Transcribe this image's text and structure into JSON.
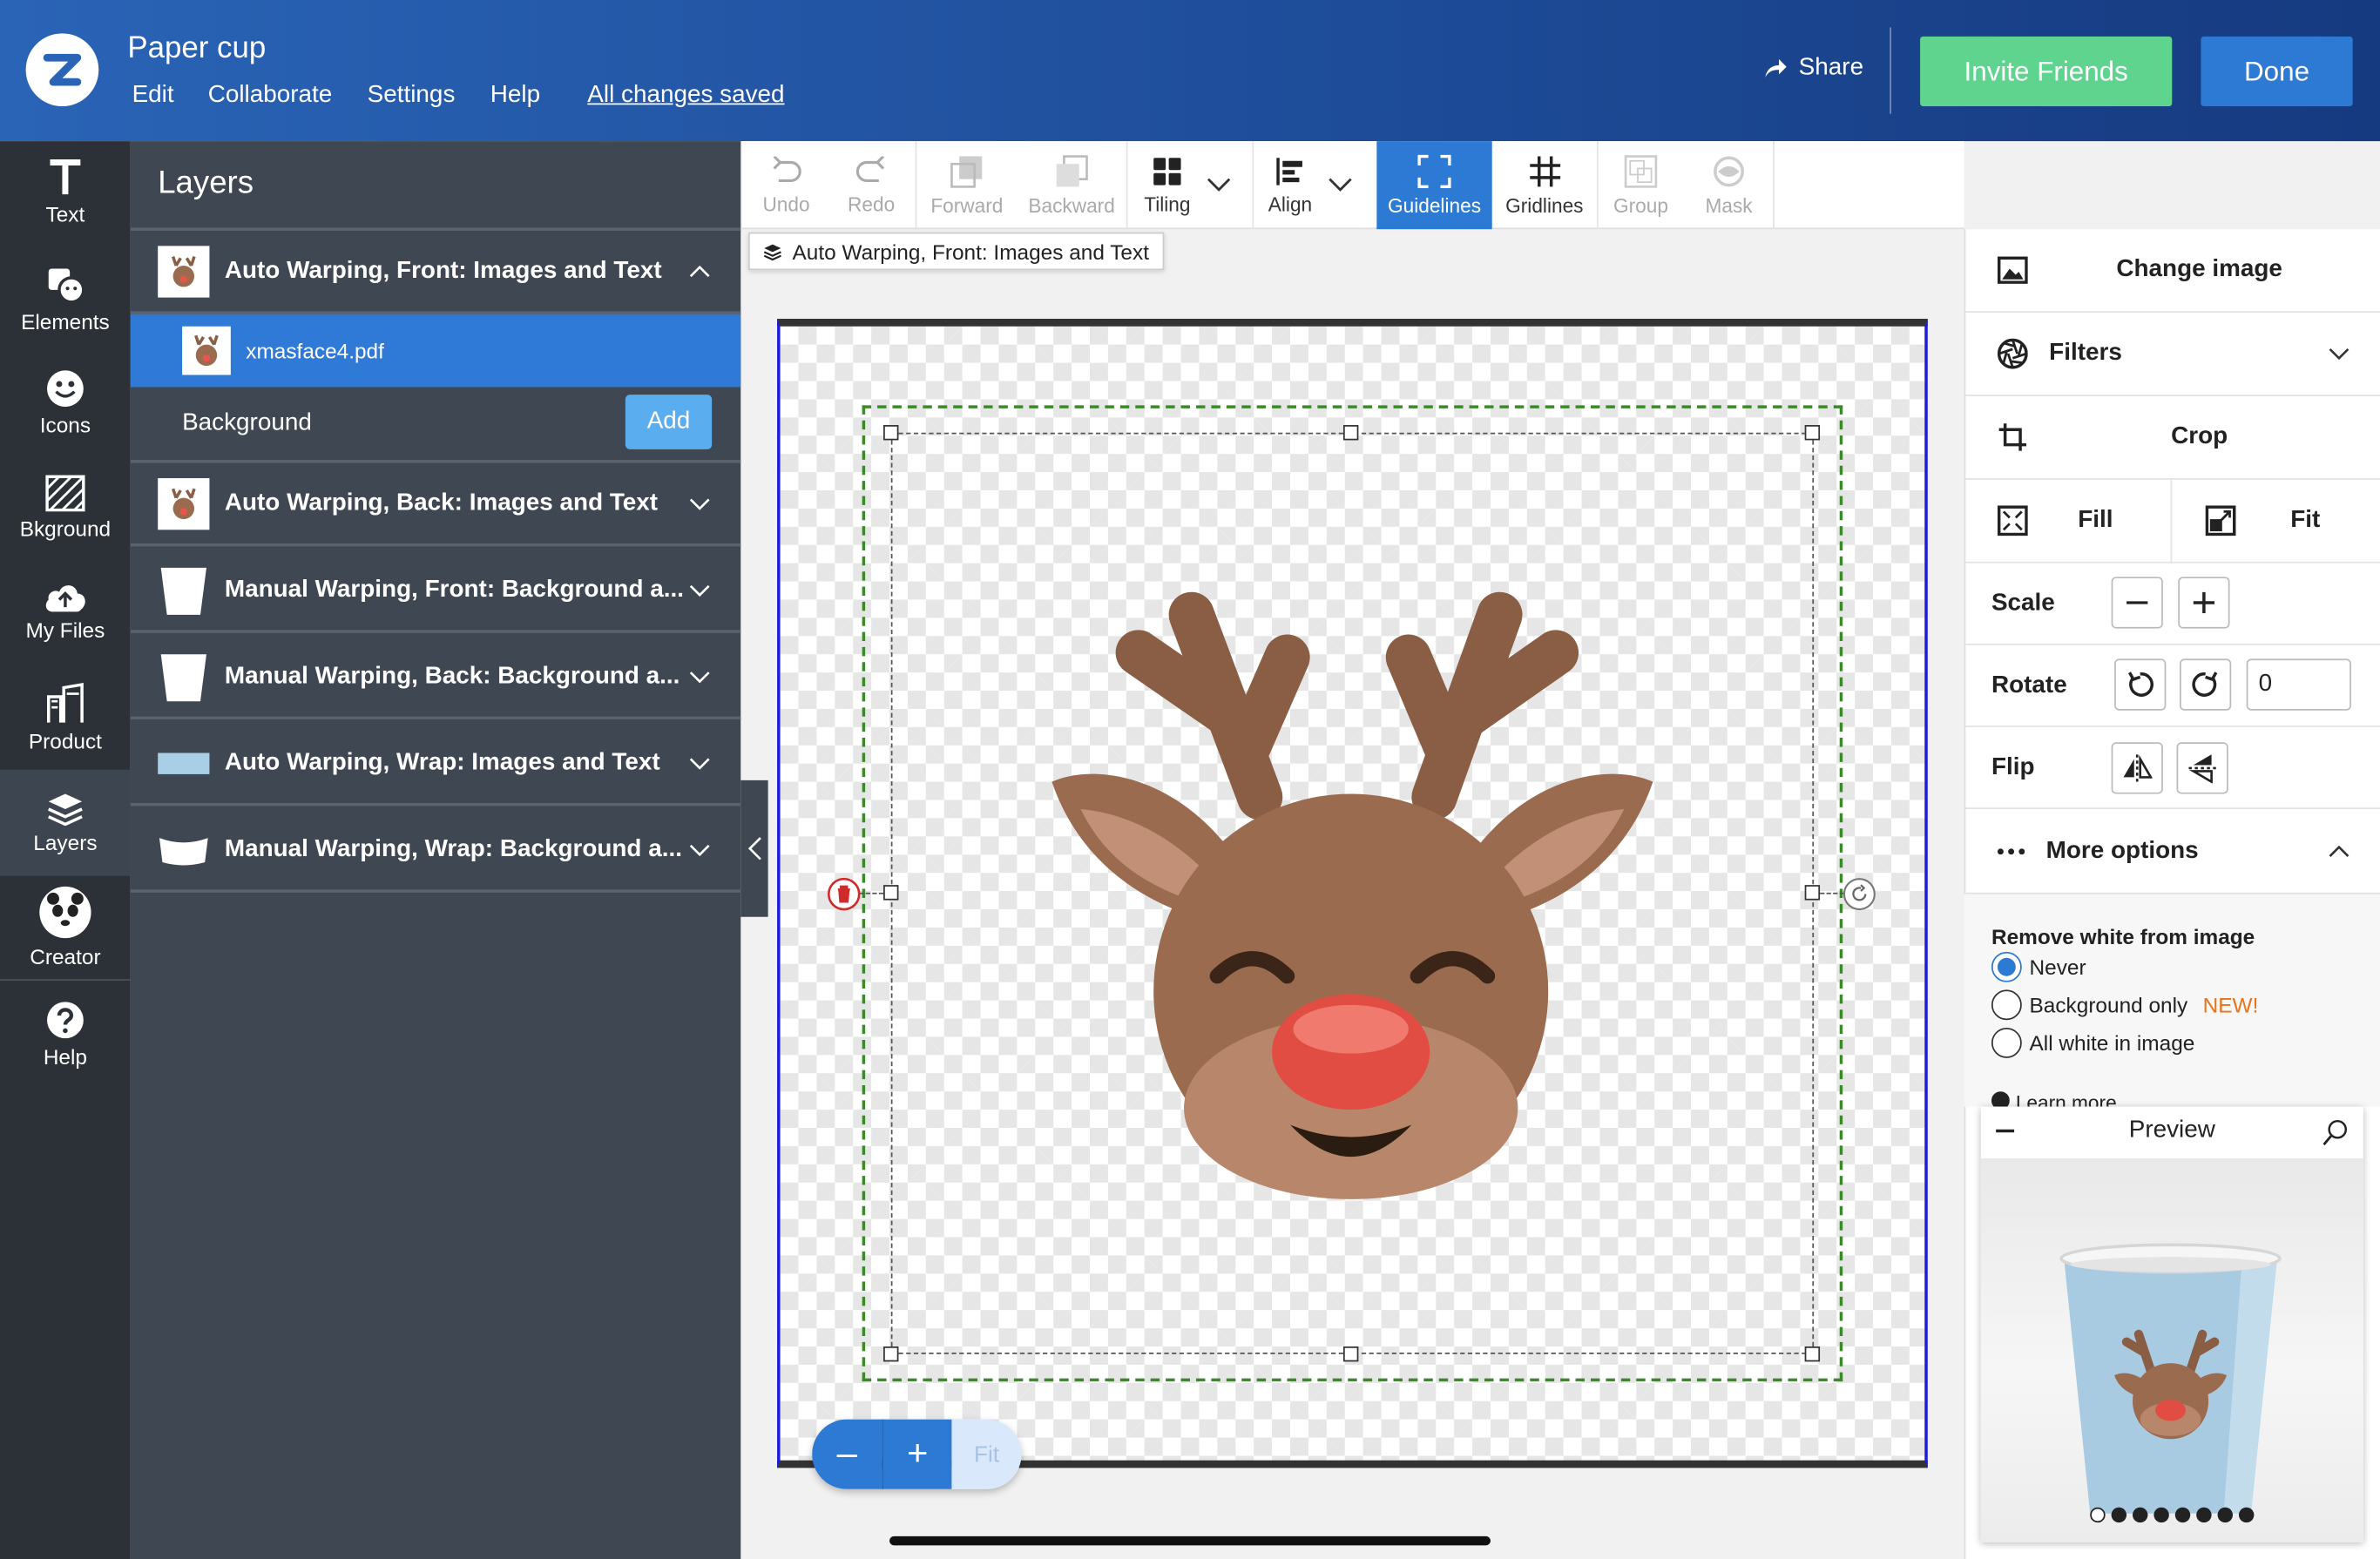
{
  "header": {
    "title": "Paper cup",
    "menu": [
      "Edit",
      "Collaborate",
      "Settings",
      "Help"
    ],
    "saved_status": "All changes saved",
    "share_label": "Share",
    "invite_label": "Invite Friends",
    "done_label": "Done"
  },
  "rail": {
    "items": [
      {
        "label": "Text",
        "icon": "text-icon"
      },
      {
        "label": "Elements",
        "icon": "elements-icon"
      },
      {
        "label": "Icons",
        "icon": "smiley-icon"
      },
      {
        "label": "Bkground",
        "icon": "background-icon"
      },
      {
        "label": "My Files",
        "icon": "cloud-upload-icon"
      },
      {
        "label": "Product",
        "icon": "product-icon"
      },
      {
        "label": "Layers",
        "icon": "layers-icon",
        "active": true
      },
      {
        "label": "Creator",
        "icon": "creator-icon"
      },
      {
        "label": "Help",
        "icon": "help-icon"
      }
    ]
  },
  "layers": {
    "title": "Layers",
    "items": [
      {
        "label": "Auto Warping, Front: Images and Text",
        "expanded": true
      },
      {
        "label": "xmasface4.pdf",
        "selected": true
      },
      {
        "label": "Background",
        "action": "Add"
      },
      {
        "label": "Auto Warping, Back: Images and Text"
      },
      {
        "label": "Manual Warping, Front: Background a..."
      },
      {
        "label": "Manual Warping, Back: Background a..."
      },
      {
        "label": "Auto Warping, Wrap: Images and Text"
      },
      {
        "label": "Manual Warping, Wrap: Background a..."
      }
    ]
  },
  "toolbar": {
    "undo": "Undo",
    "redo": "Redo",
    "forward": "Forward",
    "backward": "Backward",
    "tiling": "Tiling",
    "align": "Align",
    "guidelines": "Guidelines",
    "gridlines": "Gridlines",
    "group": "Group",
    "mask": "Mask"
  },
  "breadcrumb": "Auto Warping, Front: Images and Text",
  "zoom": {
    "minus": "–",
    "plus": "+",
    "fit": "Fit"
  },
  "right_panel": {
    "change_image": "Change image",
    "filters": "Filters",
    "crop": "Crop",
    "fill": "Fill",
    "fit": "Fit",
    "scale": "Scale",
    "rotate": "Rotate",
    "rotate_value": "0",
    "flip": "Flip",
    "more_options": "More options",
    "remove_white": {
      "heading": "Remove white from image",
      "options": [
        "Never",
        "Background only",
        "All white in image"
      ],
      "selected": "Never",
      "new_badge": "NEW!",
      "learn_more": "Learn more"
    }
  },
  "preview": {
    "title": "Preview",
    "dots_total": 8,
    "dots_active": 1
  },
  "colors": {
    "brand_blue": "#2d7ad4",
    "invite_green": "#5fd48e",
    "header_dark": "#163a80",
    "guide_green": "#3a8a28",
    "new_orange": "#e8731a"
  }
}
